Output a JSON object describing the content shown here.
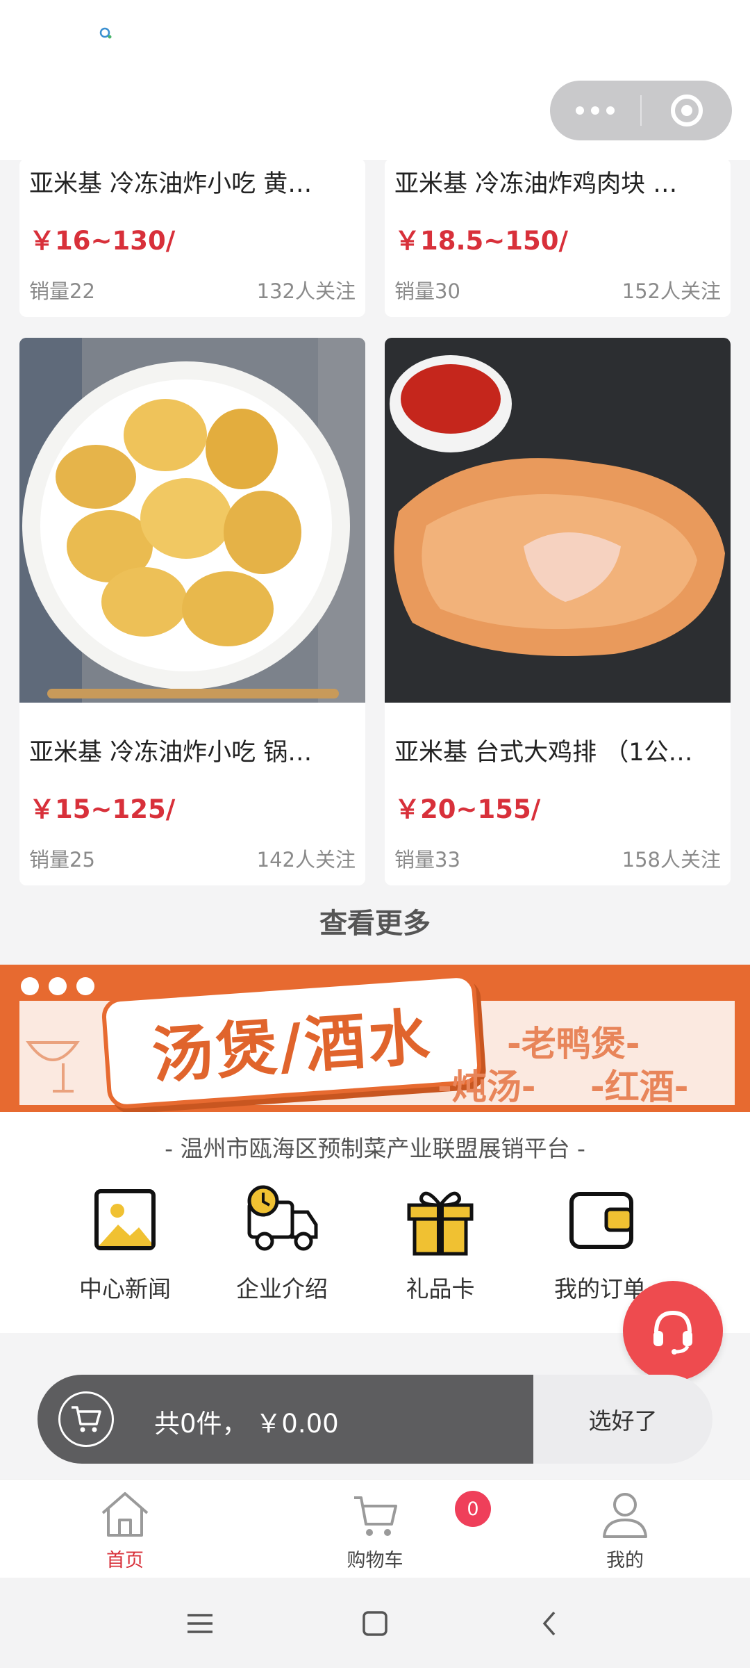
{
  "capsule": {
    "more_icon": "more-dots-icon",
    "close_icon": "target-close-icon"
  },
  "products": [
    {
      "title": "亚米基 冷冻油炸小吃 黄…",
      "price": "￥16~130/",
      "sales": "销量22",
      "follow": "132人关注"
    },
    {
      "title": "亚米基 冷冻油炸鸡肉块 …",
      "price": "￥18.5~150/",
      "sales": "销量30",
      "follow": "152人关注"
    },
    {
      "title": "亚米基 冷冻油炸小吃 锅…",
      "price": "￥15~125/",
      "sales": "销量25",
      "follow": "142人关注"
    },
    {
      "title": "亚米基 台式大鸡排 （1公…",
      "price": "￥20~155/",
      "sales": "销量33",
      "follow": "158人关注"
    }
  ],
  "see_more": "查看更多",
  "banner": {
    "headline": "汤煲/酒水",
    "tag1": "-老鸭煲-",
    "tag2": "-炖汤-",
    "tag3": "-红酒-",
    "colors": {
      "orange": "#e76a30"
    }
  },
  "slogan": "- 温州市瓯海区预制菜产业联盟展销平台 -",
  "quick_links": [
    {
      "label": "中心新闻",
      "icon": "image-icon"
    },
    {
      "label": "企业介绍",
      "icon": "delivery-truck-icon"
    },
    {
      "label": "礼品卡",
      "icon": "gift-icon"
    },
    {
      "label": "我的订单",
      "icon": "wallet-icon"
    }
  ],
  "cart": {
    "total": "共0件， ￥0.00",
    "confirm": "选好了"
  },
  "tabs": [
    {
      "label": "首页",
      "icon": "home-icon",
      "active": true
    },
    {
      "label": "购物车",
      "icon": "cart-icon",
      "badge": "0"
    },
    {
      "label": "我的",
      "icon": "user-icon"
    }
  ],
  "accent_color": "#d8303a"
}
